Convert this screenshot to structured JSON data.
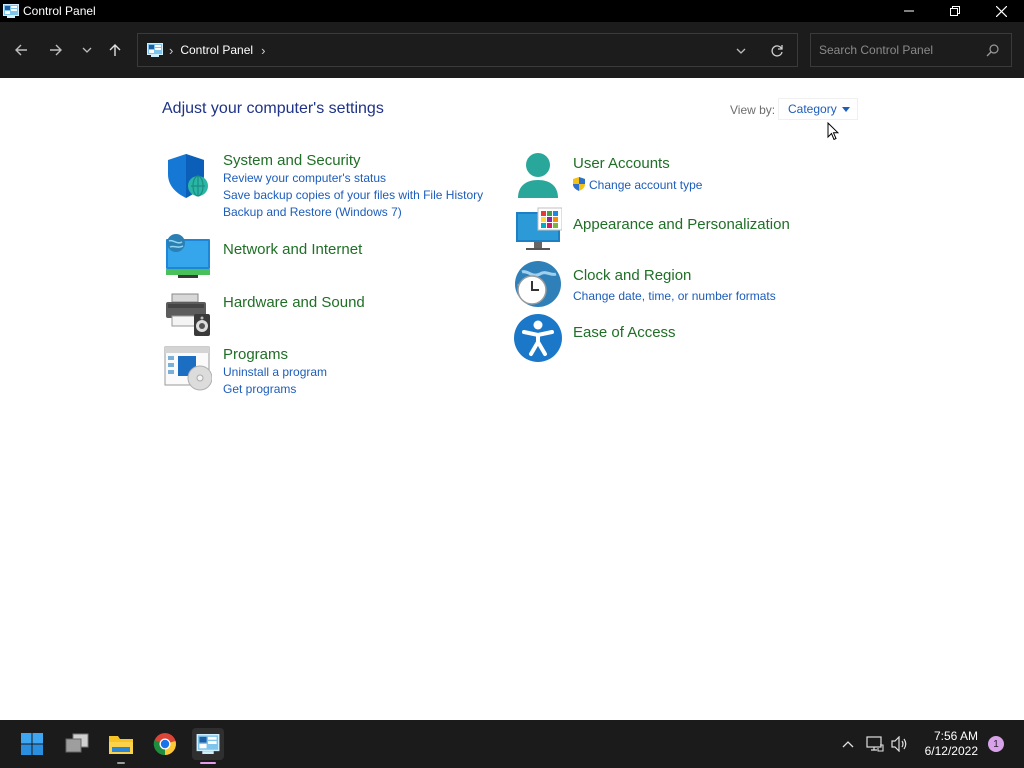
{
  "window": {
    "title": "Control Panel",
    "icon": "control-panel-icon",
    "controls": [
      "minimize-icon",
      "restore-icon",
      "close-icon"
    ]
  },
  "toolbar": {
    "nav_icons": [
      "back-arrow-icon",
      "forward-arrow-icon",
      "recent-chevron-icon",
      "up-arrow-icon"
    ],
    "breadcrumb": [
      "Control Panel"
    ],
    "search_placeholder": "Search Control Panel"
  },
  "content": {
    "heading": "Adjust your computer's settings",
    "view_by_label": "View by:",
    "view_by_value": "Category",
    "categories_left": [
      {
        "title": "System and Security",
        "icon": "shield-icon",
        "links": [
          "Review your computer's status",
          "Save backup copies of your files with File History",
          "Backup and Restore (Windows 7)"
        ]
      },
      {
        "title": "Network and Internet",
        "icon": "network-globe-icon",
        "links": []
      },
      {
        "title": "Hardware and Sound",
        "icon": "printer-speaker-icon",
        "links": []
      },
      {
        "title": "Programs",
        "icon": "programs-disc-icon",
        "links": [
          "Uninstall a program",
          "Get programs"
        ]
      }
    ],
    "categories_right": [
      {
        "title": "User Accounts",
        "icon": "user-icon",
        "links": [
          "Change account type"
        ]
      },
      {
        "title": "Appearance and Personalization",
        "icon": "monitor-palette-icon",
        "links": []
      },
      {
        "title": "Clock and Region",
        "icon": "globe-clock-icon",
        "links": [
          "Change date, time, or number formats"
        ]
      },
      {
        "title": "Ease of Access",
        "icon": "accessibility-icon",
        "links": []
      }
    ]
  },
  "taskbar": {
    "apps": [
      "start-icon",
      "task-view-icon",
      "file-explorer-icon",
      "chrome-icon",
      "control-panel-icon"
    ],
    "tray_icons": [
      "chevron-up-icon",
      "network-icon",
      "volume-icon"
    ],
    "time": "7:56 AM",
    "date": "6/12/2022",
    "notification_count": "1"
  },
  "colors": {
    "category_title": "#1f6f26",
    "link": "#1d5dbb",
    "heading": "#1e3287",
    "titlebar": "#000000",
    "toolbar": "#1c1c1c",
    "taskbar": "#1b1b1b",
    "active_indicator": "#e49ce8"
  }
}
